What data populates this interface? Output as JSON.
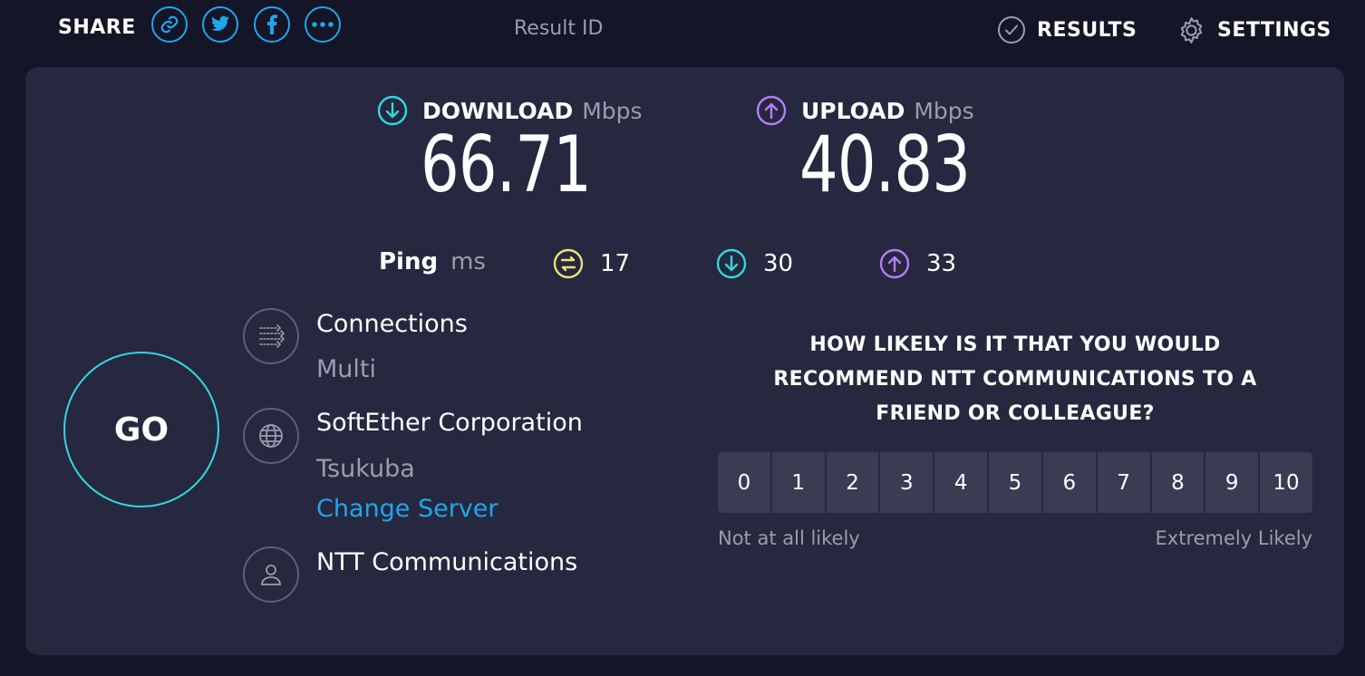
{
  "header": {
    "share_label": "SHARE",
    "share_buttons": [
      {
        "icon": "link-icon"
      },
      {
        "icon": "twitter-icon"
      },
      {
        "icon": "facebook-icon"
      },
      {
        "icon": "more-icon"
      }
    ],
    "result_id_label": "Result ID",
    "results_label": "RESULTS",
    "settings_label": "SETTINGS"
  },
  "metrics": {
    "download": {
      "label": "DOWNLOAD",
      "unit": "Mbps",
      "value": "66.71",
      "color": "#2fd8e0"
    },
    "upload": {
      "label": "UPLOAD",
      "unit": "Mbps",
      "value": "40.83",
      "color": "#b57cf5"
    }
  },
  "ping": {
    "label": "Ping",
    "unit": "ms",
    "idle": {
      "value": "17",
      "color": "#f4df7a"
    },
    "download": {
      "value": "30",
      "color": "#2fd8e0"
    },
    "upload": {
      "value": "33",
      "color": "#b57cf5"
    }
  },
  "go_label": "GO",
  "connection": {
    "title": "Connections",
    "mode": "Multi"
  },
  "server": {
    "name": "SoftEther Corporation",
    "location": "Tsukuba",
    "change_link": "Change Server"
  },
  "provider": {
    "name": "NTT Communications"
  },
  "survey": {
    "question_lines": [
      "HOW LIKELY IS IT THAT YOU WOULD",
      "RECOMMEND NTT COMMUNICATIONS TO A",
      "FRIEND OR COLLEAGUE?"
    ],
    "scale": [
      "0",
      "1",
      "2",
      "3",
      "4",
      "5",
      "6",
      "7",
      "8",
      "9",
      "10"
    ],
    "low_label": "Not at all likely",
    "high_label": "Extremely Likely"
  },
  "colors": {
    "background": "#141526",
    "panel": "#26283f",
    "accent_blue": "#1fa6ee",
    "muted_text": "#9b9cae"
  }
}
